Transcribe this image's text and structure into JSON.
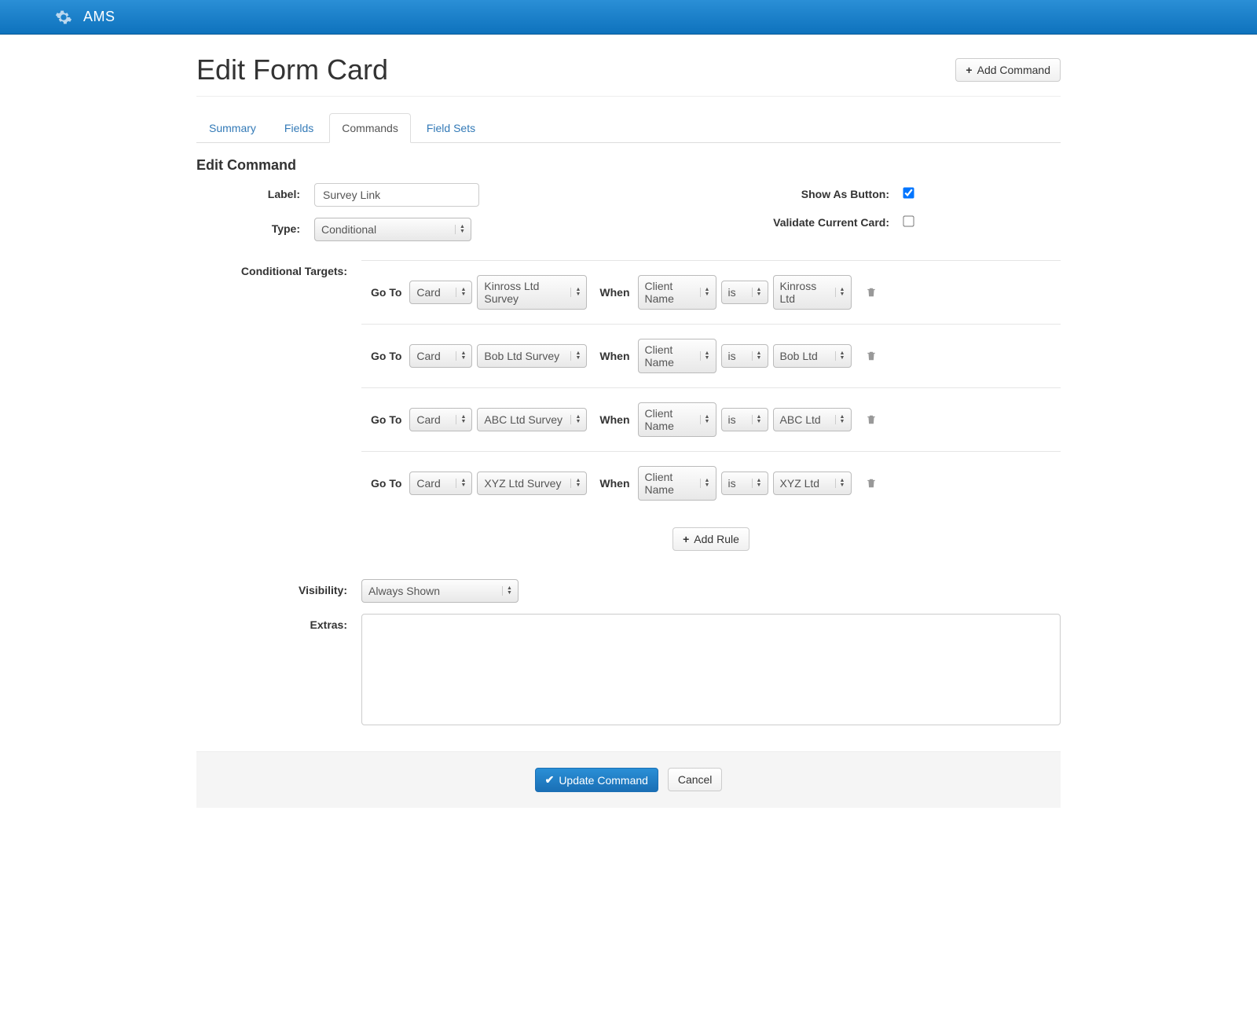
{
  "header": {
    "brand": "AMS"
  },
  "page": {
    "title": "Edit Form Card",
    "add_command_label": "Add Command"
  },
  "tabs": [
    {
      "label": "Summary",
      "active": false
    },
    {
      "label": "Fields",
      "active": false
    },
    {
      "label": "Commands",
      "active": true
    },
    {
      "label": "Field Sets",
      "active": false
    }
  ],
  "section": {
    "title": "Edit Command",
    "label_label": "Label:",
    "label_value": "Survey Link",
    "type_label": "Type:",
    "type_value": "Conditional",
    "show_as_button_label": "Show As Button:",
    "show_as_button_checked": true,
    "validate_label": "Validate Current Card:",
    "validate_checked": false
  },
  "targets": {
    "label": "Conditional Targets:",
    "goto_kw": "Go To",
    "when_kw": "When",
    "add_rule_label": "Add Rule",
    "rows": [
      {
        "goto_type": "Card",
        "goto_target": "Kinross Ltd Survey",
        "field": "Client Name",
        "op": "is",
        "value": "Kinross Ltd"
      },
      {
        "goto_type": "Card",
        "goto_target": "Bob Ltd Survey",
        "field": "Client Name",
        "op": "is",
        "value": "Bob Ltd"
      },
      {
        "goto_type": "Card",
        "goto_target": "ABC Ltd Survey",
        "field": "Client Name",
        "op": "is",
        "value": "ABC Ltd"
      },
      {
        "goto_type": "Card",
        "goto_target": "XYZ Ltd Survey",
        "field": "Client Name",
        "op": "is",
        "value": "XYZ Ltd"
      }
    ]
  },
  "visibility": {
    "label": "Visibility:",
    "value": "Always Shown"
  },
  "extras": {
    "label": "Extras:",
    "value": ""
  },
  "footer": {
    "update_label": "Update Command",
    "cancel_label": "Cancel"
  }
}
